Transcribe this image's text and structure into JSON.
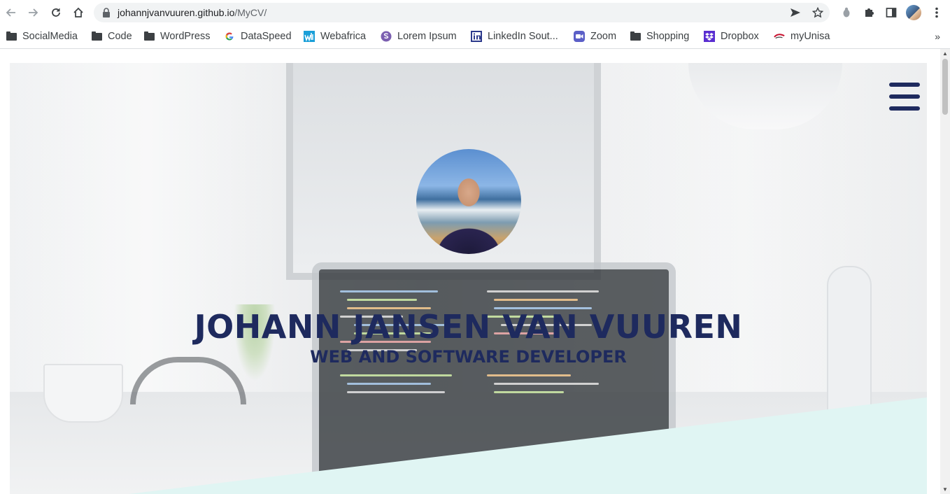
{
  "browser": {
    "url_host": "johannjvanvuuren.github.io",
    "url_path": "/MyCV/"
  },
  "bookmarks": [
    {
      "label": "SocialMedia",
      "icon": "folder-icon"
    },
    {
      "label": "Code",
      "icon": "folder-icon"
    },
    {
      "label": "WordPress",
      "icon": "folder-icon"
    },
    {
      "label": "DataSpeed",
      "icon": "google-icon"
    },
    {
      "label": "Webafrica",
      "icon": "webafrica-icon"
    },
    {
      "label": "Lorem Ipsum",
      "icon": "lorem-ipsum-icon"
    },
    {
      "label": "LinkedIn Sout...",
      "icon": "linkedin-icon"
    },
    {
      "label": "Zoom",
      "icon": "zoom-icon"
    },
    {
      "label": "Shopping",
      "icon": "folder-icon"
    },
    {
      "label": "Dropbox",
      "icon": "dropbox-icon"
    },
    {
      "label": "myUnisa",
      "icon": "unisa-icon"
    }
  ],
  "bookmarks_more": "»",
  "hero": {
    "name": "JOHANN JANSEN VAN VUUREN",
    "subtitle": "WEB AND SOFTWARE DEVELOPER"
  },
  "colors": {
    "heading": "#1e2a5e",
    "accent_band": "#e0f5f3"
  }
}
